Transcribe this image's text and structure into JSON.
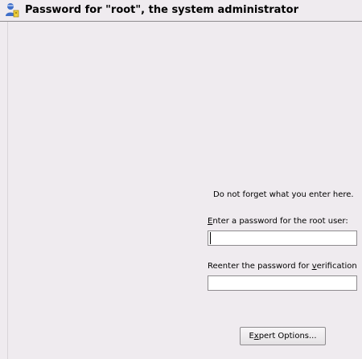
{
  "header": {
    "icon": "user-admin-icon",
    "title": "Password for \"root\", the system administrator"
  },
  "note": {
    "text": "Do not forget what you enter here."
  },
  "password_field": {
    "label_before": "",
    "label_mnemonic": "E",
    "label_after": "nter a password for the root user:",
    "value": ""
  },
  "verify_field": {
    "label_before": "Reenter the password for ",
    "label_mnemonic": "v",
    "label_after": "erification",
    "value": ""
  },
  "expert_button": {
    "label_before": "E",
    "label_mnemonic": "x",
    "label_after": "pert Options..."
  },
  "colors": {
    "background": "#efebef",
    "divider": "#8e8b8e",
    "field_background": "#ffffff",
    "icon_blue": "#3f6fc9",
    "icon_yellow": "#f0d040"
  }
}
